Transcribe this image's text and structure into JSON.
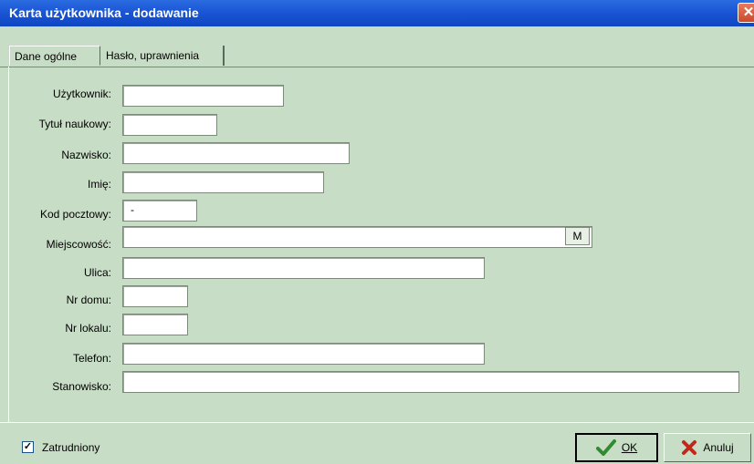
{
  "window": {
    "title": "Karta użytkownika - dodawanie",
    "close_glyph": "✕"
  },
  "tabs": [
    {
      "label": "Dane ogólne",
      "active": true
    },
    {
      "label": "Hasło, uprawnienia",
      "active": false
    }
  ],
  "form": {
    "uzytkownik": {
      "label": "Użytkownik:",
      "value": ""
    },
    "tytul": {
      "label": "Tytuł naukowy:",
      "value": ""
    },
    "nazwisko": {
      "label": "Nazwisko:",
      "value": ""
    },
    "imie": {
      "label": "Imię:",
      "value": ""
    },
    "kod": {
      "label": "Kod pocztowy:",
      "value": "-"
    },
    "miejscowosc": {
      "label": "Miejscowość:",
      "value": "",
      "button": "M"
    },
    "ulica": {
      "label": "Ulica:",
      "value": ""
    },
    "nr_domu": {
      "label": "Nr domu:",
      "value": ""
    },
    "nr_lokalu": {
      "label": "Nr lokalu:",
      "value": ""
    },
    "telefon": {
      "label": "Telefon:",
      "value": ""
    },
    "stanowisko": {
      "label": "Stanowisko:",
      "value": ""
    }
  },
  "footer": {
    "zatrudniony": {
      "label": "Zatrudniony",
      "checked": true,
      "check_glyph": "✓"
    },
    "ok_label": "OK",
    "ok_icon": "check-icon",
    "cancel_label": "Anuluj",
    "cancel_icon": "x-icon"
  },
  "colors": {
    "background": "#c8ddc6",
    "titlebar": "#1a56d6",
    "ok_icon": "#2e8b2e",
    "cancel_icon": "#c0281c"
  }
}
